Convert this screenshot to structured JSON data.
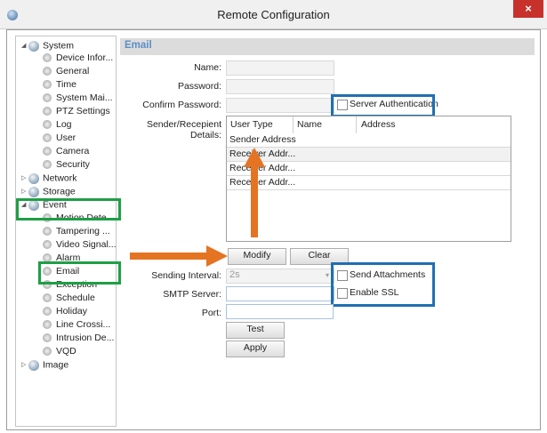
{
  "window": {
    "title": "Remote Configuration",
    "close_glyph": "×",
    "app_icon": "app-globe-icon"
  },
  "tree": {
    "system": "System",
    "system_children": [
      "Device Infor...",
      "General",
      "Time",
      "System Mai...",
      "PTZ Settings",
      "Log",
      "User",
      "Camera",
      "Security"
    ],
    "network": "Network",
    "storage": "Storage",
    "event": "Event",
    "event_children": [
      "Motion Dete...",
      "Tampering ...",
      "Video Signal...",
      "Alarm",
      "Email",
      "Exception",
      "Schedule",
      "Holiday",
      "Line Crossi...",
      "Intrusion De...",
      "VQD"
    ],
    "image": "Image"
  },
  "email": {
    "title": "Email",
    "name_label": "Name:",
    "name_value": "",
    "password_label": "Password:",
    "password_value": "",
    "confirm_label": "Confirm Password:",
    "confirm_value": "",
    "server_auth_label": "Server Authentication",
    "server_auth_checked": false,
    "details_label": "Sender/Recepient Details:",
    "table": {
      "headers": [
        "User Type",
        "Name",
        "Address"
      ],
      "rows": [
        [
          "Sender Address",
          "",
          ""
        ],
        [
          "Receiver Addr...",
          "",
          ""
        ],
        [
          "Receiver Addr...",
          "",
          ""
        ],
        [
          "Receiver Addr...",
          "",
          ""
        ]
      ]
    },
    "modify_label": "Modify",
    "clear_label": "Clear",
    "interval_label": "Sending Interval:",
    "interval_value": "2s",
    "send_attach_label": "Send Attachments",
    "send_attach_checked": false,
    "smtp_label": "SMTP Server:",
    "smtp_value": "",
    "ssl_label": "Enable SSL",
    "ssl_checked": false,
    "port_label": "Port:",
    "port_value": "",
    "test_label": "Test",
    "apply_label": "Apply"
  },
  "colors": {
    "highlight_blue": "#1f6fb2",
    "highlight_green": "#1e9f45",
    "arrow_orange": "#e47422",
    "header_blue": "#5a8fc6"
  }
}
